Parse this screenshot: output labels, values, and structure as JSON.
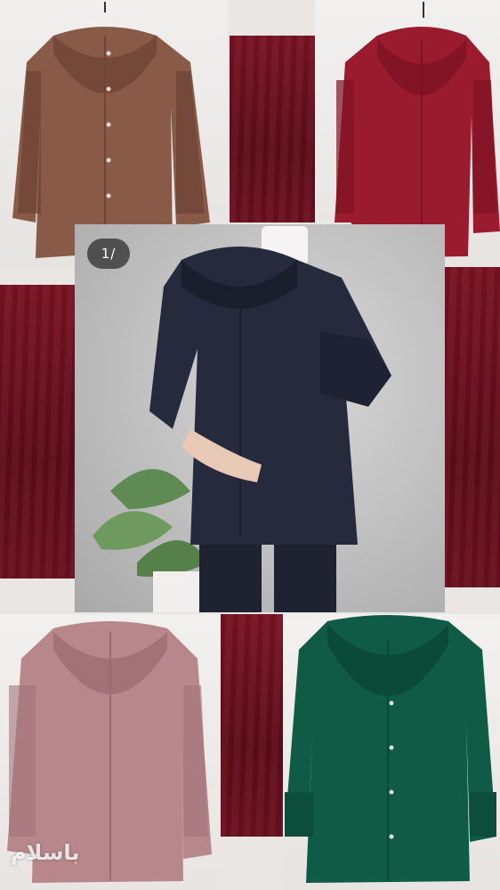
{
  "image_counter": {
    "label": "1/"
  },
  "watermark": {
    "text": "باسلام"
  },
  "colors": {
    "brown": "#8a5a48",
    "burgundy": "#9b1b2e",
    "navy": "#262a3d",
    "mauve": "#b8878c",
    "green": "#0f5b45",
    "maroon_bg": "#6a0f1e"
  }
}
